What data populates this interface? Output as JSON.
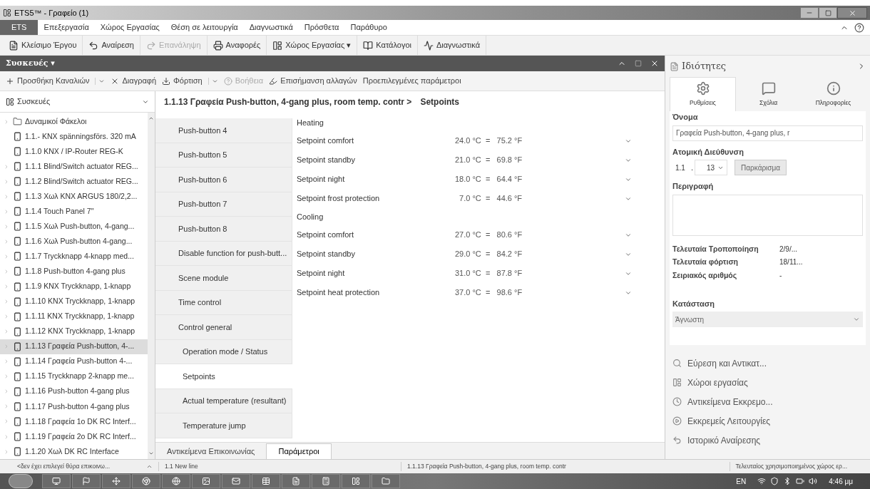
{
  "window": {
    "title": "ETS5™ - Γραφείο (1)"
  },
  "menu": [
    {
      "label": "ETS",
      "selected": true
    },
    {
      "label": "Επεξεργασία",
      "selected": false
    },
    {
      "label": "Χώρος Εργασίας",
      "selected": false
    },
    {
      "label": "Θέση σε λειτουργία",
      "selected": false
    },
    {
      "label": "Διαγνωστικά",
      "selected": false
    },
    {
      "label": "Πρόσθετα",
      "selected": false
    },
    {
      "label": "Παράθυρο",
      "selected": false
    }
  ],
  "toolbar": [
    {
      "kind": "close",
      "label": "Κλείσιμο Έργου",
      "disabled": false
    },
    {
      "kind": "undo",
      "label": "Αναίρεση",
      "disabled": false
    },
    {
      "kind": "redo",
      "label": "Επανάληψη",
      "disabled": true
    },
    {
      "kind": "print",
      "label": "Αναφορές",
      "disabled": false
    },
    {
      "kind": "workspace",
      "label": "Χώρος Εργασίας ▾",
      "disabled": false
    },
    {
      "kind": "catalog",
      "label": "Κατάλογοι",
      "disabled": false
    },
    {
      "kind": "diag",
      "label": "Διαγνωστικά",
      "disabled": false
    }
  ],
  "panel": {
    "title": "Συσκευές ▾"
  },
  "panel_toolbar": [
    {
      "kind": "add",
      "label": "Προσθήκη Καναλιών",
      "disabled": false,
      "split": true
    },
    {
      "kind": "delete",
      "label": "Διαγραφή",
      "disabled": false,
      "split": false
    },
    {
      "kind": "download",
      "label": "Φόρτιση",
      "disabled": false,
      "split": true
    },
    {
      "kind": "help",
      "label": "Βοήθεια",
      "disabled": true,
      "split": false
    },
    {
      "kind": "highlight",
      "label": "Επισήμανση αλλαγών",
      "disabled": false,
      "split": false
    },
    {
      "kind": "none",
      "label": "Προεπιλεγμένες παράμετροι",
      "disabled": false,
      "split": false
    }
  ],
  "tree": {
    "header": "Συσκευές",
    "items": [
      {
        "kind": "folder",
        "label": "Δυναμικοί Φάκελοι",
        "expandable": true,
        "selected": false
      },
      {
        "kind": "device",
        "label": "1.1.- KNX spänningsförs. 320 mA",
        "expandable": false,
        "selected": false
      },
      {
        "kind": "device",
        "label": "1.1.0 KNX / IP-Router REG-K",
        "expandable": false,
        "selected": false
      },
      {
        "kind": "device",
        "label": "1.1.1 Blind/Switch actuator REG...",
        "expandable": true,
        "selected": false
      },
      {
        "kind": "device",
        "label": "1.1.2 Blind/Switch actuator REG...",
        "expandable": true,
        "selected": false
      },
      {
        "kind": "device",
        "label": "1.1.3 Χωλ KNX ARGUS 180/2,2...",
        "expandable": true,
        "selected": false
      },
      {
        "kind": "device",
        "label": "1.1.4 Touch Panel 7\"",
        "expandable": true,
        "selected": false
      },
      {
        "kind": "device",
        "label": "1.1.5 Χωλ Push-button, 4-gang...",
        "expandable": true,
        "selected": false
      },
      {
        "kind": "device",
        "label": "1.1.6 Χωλ Push-button 4-gang...",
        "expandable": true,
        "selected": false
      },
      {
        "kind": "device",
        "label": "1.1.7 Tryckknapp 4-knapp med...",
        "expandable": true,
        "selected": false
      },
      {
        "kind": "device",
        "label": "1.1.8 Push-button 4-gang plus",
        "expandable": true,
        "selected": false
      },
      {
        "kind": "device",
        "label": "1.1.9 KNX Tryckknapp, 1-knapp",
        "expandable": true,
        "selected": false
      },
      {
        "kind": "device",
        "label": "1.1.10 KNX Tryckknapp, 1-knapp",
        "expandable": true,
        "selected": false
      },
      {
        "kind": "device",
        "label": "1.1.11 KNX Tryckknapp, 1-knapp",
        "expandable": true,
        "selected": false
      },
      {
        "kind": "device",
        "label": "1.1.12 KNX Tryckknapp, 1-knapp",
        "expandable": true,
        "selected": false
      },
      {
        "kind": "device",
        "label": "1.1.13 Γραφεία Push-button, 4-...",
        "expandable": true,
        "selected": true
      },
      {
        "kind": "device",
        "label": "1.1.14 Γραφεία Push-button 4-...",
        "expandable": true,
        "selected": false
      },
      {
        "kind": "device",
        "label": "1.1.15 Tryckknapp 2-knapp me...",
        "expandable": true,
        "selected": false
      },
      {
        "kind": "device",
        "label": "1.1.16 Push-button 4-gang plus",
        "expandable": true,
        "selected": false
      },
      {
        "kind": "device",
        "label": "1.1.17 Push-button 4-gang plus",
        "expandable": true,
        "selected": false
      },
      {
        "kind": "device",
        "label": "1.1.18 Γραφεία 1ο DK RC Interf...",
        "expandable": true,
        "selected": false
      },
      {
        "kind": "device",
        "label": "1.1.19 Γραφεία 2ο DK RC Interf...",
        "expandable": true,
        "selected": false
      },
      {
        "kind": "device",
        "label": "1.1.20 Χωλ DK RC Interface",
        "expandable": true,
        "selected": false
      }
    ]
  },
  "breadcrumb": {
    "device": "1.1.13 Γραφεία Push-button, 4-gang plus, room temp. contr >",
    "page": "Setpoints"
  },
  "parameter_pages": [
    {
      "kind": "page",
      "label": "Push-button 4",
      "selected": false
    },
    {
      "kind": "page",
      "label": "Push-button 5",
      "selected": false
    },
    {
      "kind": "page",
      "label": "Push-button 6",
      "selected": false
    },
    {
      "kind": "page",
      "label": "Push-button 7",
      "selected": false
    },
    {
      "kind": "page",
      "label": "Push-button 8",
      "selected": false
    },
    {
      "kind": "page",
      "label": "Disable function for push-butt...",
      "selected": false
    },
    {
      "kind": "page",
      "label": "Scene module",
      "selected": false
    },
    {
      "kind": "page",
      "label": "Time control",
      "selected": false
    },
    {
      "kind": "page",
      "label": "Control general",
      "selected": false
    },
    {
      "kind": "subpage",
      "label": "Operation mode / Status",
      "selected": false
    },
    {
      "kind": "subpage",
      "label": "Setpoints",
      "selected": true
    },
    {
      "kind": "subpage",
      "label": "Actual temperature (resultant)",
      "selected": false
    },
    {
      "kind": "subpage",
      "label": "Temperature jump",
      "selected": false
    }
  ],
  "parameters": [
    {
      "kind": "heading",
      "label": "Heating"
    },
    {
      "kind": "select",
      "label": "Setpoint comfort",
      "value": "24.0 °C  =   75.2 °F"
    },
    {
      "kind": "select",
      "label": "Setpoint standby",
      "value": "21.0 °C  =   69.8 °F"
    },
    {
      "kind": "select",
      "label": "Setpoint night",
      "value": "18.0 °C  =   64.4 °F"
    },
    {
      "kind": "select",
      "label": "Setpoint frost protection",
      "value": "  7.0 °C  =   44.6 °F"
    },
    {
      "kind": "heading",
      "label": "Cooling"
    },
    {
      "kind": "select",
      "label": "Setpoint comfort",
      "value": "27.0 °C  =   80.6 °F"
    },
    {
      "kind": "select",
      "label": "Setpoint standby",
      "value": "29.0 °C  =   84.2 °F"
    },
    {
      "kind": "select",
      "label": "Setpoint night",
      "value": "31.0 °C  =   87.8 °F"
    },
    {
      "kind": "select",
      "label": "Setpoint heat protection",
      "value": "37.0 °C  =   98.6 °F"
    }
  ],
  "bottom_tabs": [
    {
      "label": "Αντικείμενα Επικοινωνίας",
      "selected": false
    },
    {
      "label": "Παράμετροι",
      "selected": true
    }
  ],
  "properties": {
    "title": "Ιδιότητες",
    "tabs": [
      {
        "kind": "settings",
        "label": "Ρυθμίσεις",
        "selected": true
      },
      {
        "kind": "comments",
        "label": "Σχόλια",
        "selected": false
      },
      {
        "kind": "info",
        "label": "Πληροφορίες",
        "selected": false
      }
    ],
    "name_label": "Όνομα",
    "name_value": "Γραφεία Push-button, 4-gang plus, r",
    "address_label": "Ατομική Διεύθυνση",
    "address_line": "1.1",
    "address_sep": ".",
    "address_device": "13",
    "park_button": "Παρκάρισμα",
    "description_label": "Περιγραφή",
    "info": [
      {
        "label": "Τελευταία Τροποποίηση",
        "value": "2/9/..."
      },
      {
        "label": "Τελευταία φόρτιση",
        "value": "18/11..."
      },
      {
        "label": "Σειριακός αριθμός",
        "value": "-"
      }
    ],
    "status_label": "Κατάσταση",
    "status_value": "Άγνωστη"
  },
  "side_links": [
    {
      "kind": "search",
      "label": "Εύρεση και Αντικατ..."
    },
    {
      "kind": "workspace",
      "label": "Χώροι εργασίας"
    },
    {
      "kind": "clock",
      "label": "Αντικείμενα Εκκρεμο..."
    },
    {
      "kind": "play",
      "label": "Εκκρεμείς Λειτουργίες"
    },
    {
      "kind": "undo",
      "label": "Ιστορικό Αναίρεσης"
    }
  ],
  "status_bar": {
    "port": "<δεν έχει επιλεγεί θύρα επικοινω...",
    "line": "1.1 New line",
    "device": "1.1.13 Γραφεία Push-button, 4-gang plus, room temp. contr",
    "workspace": "Τελευταίος χρησιμοποιημένος χώρος ερ..."
  },
  "taskbar": {
    "language": "EN",
    "clock": "4:46 μμ"
  }
}
